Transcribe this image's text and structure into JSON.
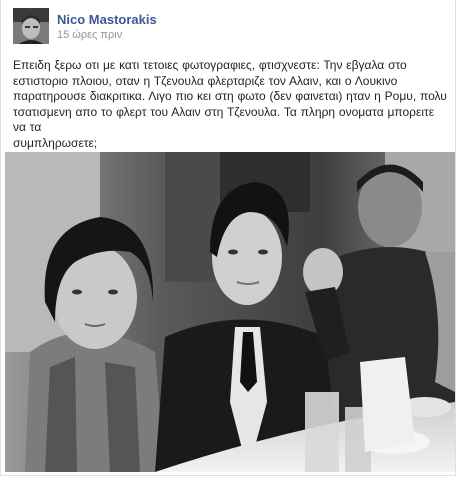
{
  "post": {
    "author": "Nico Mastorakis",
    "timestamp": "15 ώρες πριν",
    "text_lines": [
      "Επειδη ξερω οτι με κατι τετοιες φωτογραφιες, φτισχνεστε: Την εβγαλα στο",
      "εστιστοριο πλοιου, οταν η Τζενουλα φλερταριζε τον Αλαιν, και ο Λουκινο",
      "παρατηρουσε διακριτικα. Λιγο πιο κει στη φωτο (δεν φαινεται) ηταν η Ρομυ, πολυ",
      "τσατισμενη απο το φλερτ του Αλαιν στη Τζενουλα. Τα πληρη ονοματα μπορειτε να τα",
      "συμπληρωσετε;"
    ]
  },
  "colors": {
    "author_link": "#3b5998",
    "timestamp": "#90949c",
    "text": "#1d2129"
  },
  "icons": {
    "avatar": "profile-photo",
    "photo": "black-and-white-photograph"
  }
}
